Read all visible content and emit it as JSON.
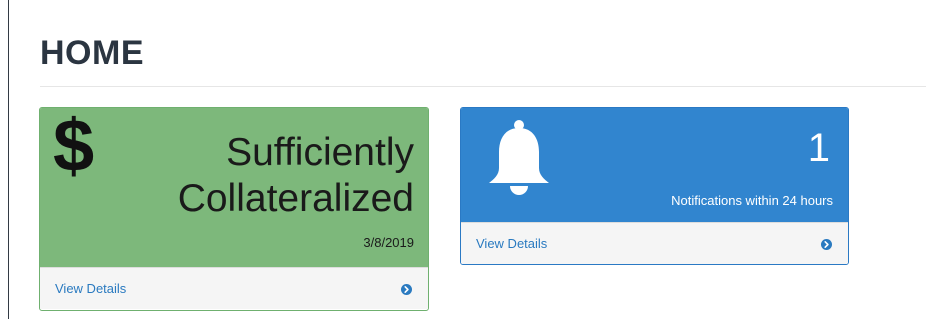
{
  "page": {
    "title": "HOME"
  },
  "collateral_panel": {
    "icon": "dollar-icon",
    "icon_glyph": "$",
    "status_line1": "Sufficiently",
    "status_line2": "Collateralized",
    "date": "3/8/2019",
    "footer_label": "View Details",
    "color": "#7db87b"
  },
  "notifications_panel": {
    "icon": "bell-icon",
    "count": "1",
    "label": "Notifications within 24 hours",
    "footer_label": "View Details",
    "color": "#3185cf"
  },
  "colors": {
    "link": "#2a7ac0",
    "title": "#2b3541"
  }
}
